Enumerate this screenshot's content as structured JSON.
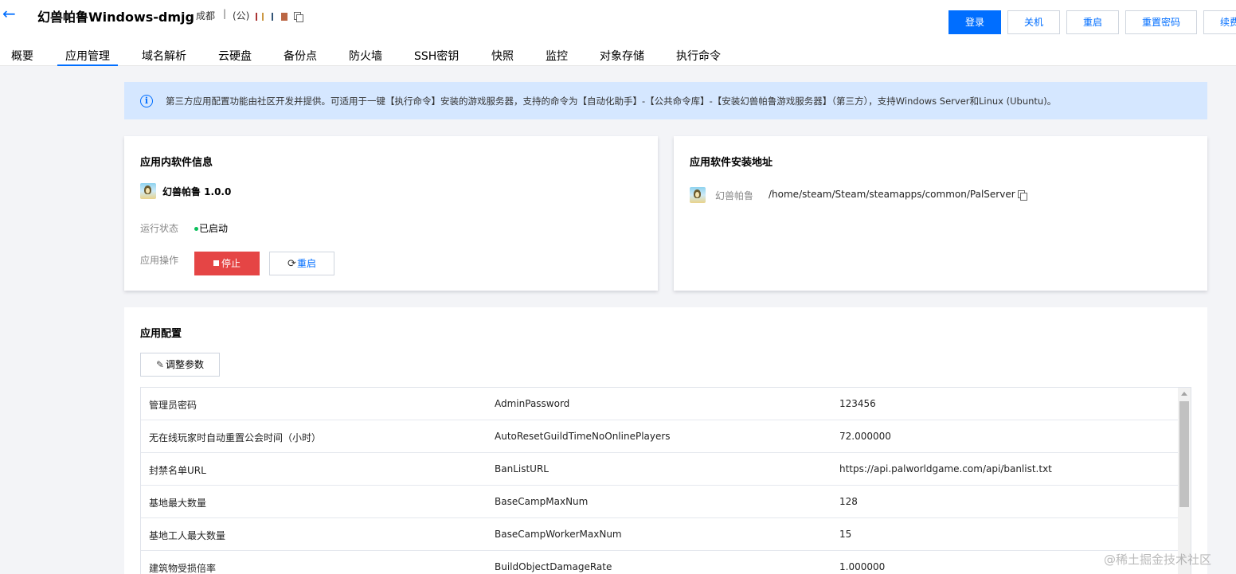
{
  "header": {
    "back_icon": "arrow-left-icon",
    "title": "幻兽帕鲁Windows-dmjg",
    "region": "成都",
    "separator": "|",
    "ip_prefix": "(公)",
    "copy_icon": "copy-icon",
    "buttons": {
      "login": "登录",
      "shutdown": "关机",
      "restart": "重启",
      "reset_password": "重置密码",
      "renew": "续费"
    },
    "accent_color": "#006eff"
  },
  "tabs": [
    {
      "label": "概要"
    },
    {
      "label": "应用管理",
      "active": true
    },
    {
      "label": "域名解析"
    },
    {
      "label": "云硬盘"
    },
    {
      "label": "备份点"
    },
    {
      "label": "防火墙"
    },
    {
      "label": "SSH密钥"
    },
    {
      "label": "快照"
    },
    {
      "label": "监控"
    },
    {
      "label": "对象存储"
    },
    {
      "label": "执行命令"
    }
  ],
  "notice": {
    "icon": "info-icon",
    "text": "第三方应用配置功能由社区开发并提供。可适用于一键【执行命令】安装的游戏服务器，支持的命令为【自动化助手】-【公共命令库】-【安装幻兽帕鲁游戏服务器】（第三方），支持Windows Server和Linux (Ubuntu)。"
  },
  "software_info": {
    "title": "应用内软件信息",
    "app_name": "幻兽帕鲁 1.0.0",
    "status_label": "运行状态",
    "status_value": "已启动",
    "status_color": "#0abf5b",
    "actions_label": "应用操作",
    "stop_button": "停止",
    "restart_button": "重启",
    "stop_color": "#e54545"
  },
  "install_path": {
    "title": "应用软件安装地址",
    "app_label": "幻兽帕鲁",
    "path": "/home/steam/Steam/steamapps/common/PalServer"
  },
  "app_config": {
    "title": "应用配置",
    "adjust_button": "调整参数",
    "rows": [
      {
        "name": "管理员密码",
        "key": "AdminPassword",
        "value": "123456"
      },
      {
        "name": "无在线玩家时自动重置公会时间（小时）",
        "key": "AutoResetGuildTimeNoOnlinePlayers",
        "value": "72.000000"
      },
      {
        "name": "封禁名单URL",
        "key": "BanListURL",
        "value": "https://api.palworldgame.com/api/banlist.txt"
      },
      {
        "name": "基地最大数量",
        "key": "BaseCampMaxNum",
        "value": "128"
      },
      {
        "name": "基地工人最大数量",
        "key": "BaseCampWorkerMaxNum",
        "value": "15"
      },
      {
        "name": "建筑物受损倍率",
        "key": "BuildObjectDamageRate",
        "value": "1.000000"
      }
    ]
  },
  "watermark": "@稀土掘金技术社区"
}
